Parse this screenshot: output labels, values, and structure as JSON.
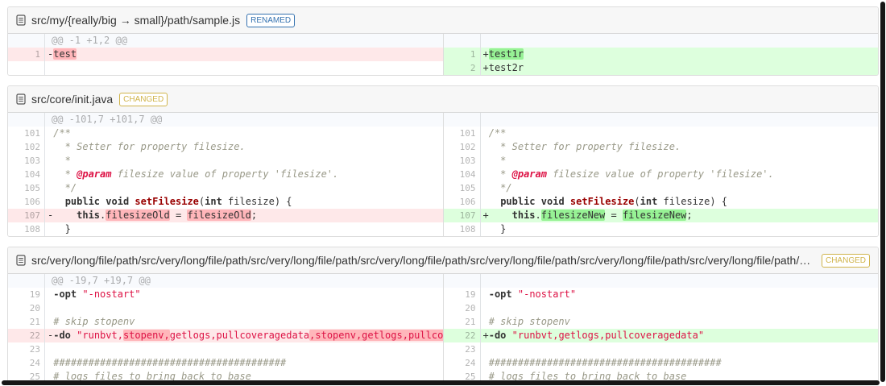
{
  "colors": {
    "renamed_badge": "#3572b0",
    "changed_badge": "#d0b44c",
    "del_line_bg": "#fee8e9",
    "del_word_highlight": "#ffb6ba",
    "ins_line_bg": "#ddffdd",
    "ins_word_highlight": "#97f295",
    "hunk_header_bg": "#f8fafd",
    "file_header_bg": "#f7f7f7"
  },
  "files": [
    {
      "name": "src/my/{really/big → small}/path/sample.js",
      "badge": "RENAMED",
      "badge_type": "renamed",
      "hunk": "@@ -1 +1,2 @@",
      "left_rows": [
        {
          "n": "1",
          "t": "del",
          "s": [
            [
              "pln",
              "-"
            ],
            [
              "hl",
              "test"
            ]
          ]
        },
        {
          "t": "blank",
          "s": []
        }
      ],
      "right_rows": [
        {
          "n": "1",
          "t": "ins",
          "s": [
            [
              "pln",
              "+"
            ],
            [
              "hl",
              "test1r"
            ]
          ]
        },
        {
          "n": "2",
          "t": "ins",
          "s": [
            [
              "pln",
              "+test2r"
            ]
          ]
        }
      ]
    },
    {
      "name": "src/core/init.java",
      "badge": "CHANGED",
      "badge_type": "changed",
      "hunk": "@@ -101,7 +101,7 @@",
      "left_rows": [
        {
          "n": "101",
          "t": "ctx",
          "s": [
            [
              "cmt",
              " /**"
            ]
          ]
        },
        {
          "n": "102",
          "t": "ctx",
          "s": [
            [
              "cmt",
              "   * Setter for property filesize."
            ]
          ]
        },
        {
          "n": "103",
          "t": "ctx",
          "s": [
            [
              "cmt",
              "   *"
            ]
          ]
        },
        {
          "n": "104",
          "t": "ctx",
          "s": [
            [
              "cmt",
              "   * "
            ],
            [
              "doc",
              "@param"
            ],
            [
              "cmt",
              " filesize value of property 'filesize'."
            ]
          ]
        },
        {
          "n": "105",
          "t": "ctx",
          "s": [
            [
              "cmt",
              "   */"
            ]
          ]
        },
        {
          "n": "106",
          "t": "ctx",
          "s": [
            [
              "pln",
              "   "
            ],
            [
              "kw",
              "public"
            ],
            [
              "pln",
              " "
            ],
            [
              "kw",
              "void"
            ],
            [
              "pln",
              " "
            ],
            [
              "title",
              "setFilesize"
            ],
            [
              "pln",
              "("
            ],
            [
              "kw",
              "int"
            ],
            [
              "pln",
              " filesize) {"
            ]
          ]
        },
        {
          "n": "107",
          "t": "del",
          "s": [
            [
              "pln",
              "-    "
            ],
            [
              "kw",
              "this"
            ],
            [
              "pln",
              "."
            ],
            [
              "hl",
              "filesizeOld"
            ],
            [
              "pln",
              " = "
            ],
            [
              "hl",
              "filesizeOld"
            ],
            [
              "pln",
              ";"
            ]
          ]
        },
        {
          "n": "108",
          "t": "ctx",
          "s": [
            [
              "pln",
              "   }"
            ]
          ]
        }
      ],
      "right_rows": [
        {
          "n": "101",
          "t": "ctx",
          "s": [
            [
              "cmt",
              " /**"
            ]
          ]
        },
        {
          "n": "102",
          "t": "ctx",
          "s": [
            [
              "cmt",
              "   * Setter for property filesize."
            ]
          ]
        },
        {
          "n": "103",
          "t": "ctx",
          "s": [
            [
              "cmt",
              "   *"
            ]
          ]
        },
        {
          "n": "104",
          "t": "ctx",
          "s": [
            [
              "cmt",
              "   * "
            ],
            [
              "doc",
              "@param"
            ],
            [
              "cmt",
              " filesize value of property 'filesize'."
            ]
          ]
        },
        {
          "n": "105",
          "t": "ctx",
          "s": [
            [
              "cmt",
              "   */"
            ]
          ]
        },
        {
          "n": "106",
          "t": "ctx",
          "s": [
            [
              "pln",
              "   "
            ],
            [
              "kw",
              "public"
            ],
            [
              "pln",
              " "
            ],
            [
              "kw",
              "void"
            ],
            [
              "pln",
              " "
            ],
            [
              "title",
              "setFilesize"
            ],
            [
              "pln",
              "("
            ],
            [
              "kw",
              "int"
            ],
            [
              "pln",
              " filesize) {"
            ]
          ]
        },
        {
          "n": "107",
          "t": "ins",
          "s": [
            [
              "pln",
              "+    "
            ],
            [
              "kw",
              "this"
            ],
            [
              "pln",
              "."
            ],
            [
              "hl",
              "filesizeNew"
            ],
            [
              "pln",
              " = "
            ],
            [
              "hl",
              "filesizeNew"
            ],
            [
              "pln",
              ";"
            ]
          ]
        },
        {
          "n": "108",
          "t": "ctx",
          "s": [
            [
              "pln",
              "   }"
            ]
          ]
        }
      ]
    },
    {
      "name": "src/very/long/file/path/src/very/long/file/path/src/very/long/file/path/src/very/long/file/path/src/very/long/file/path/src/very/long/file/path/src/very/long/file/path/src/very/long/file/path",
      "badge": "CHANGED",
      "badge_type": "changed",
      "hunk": "@@ -19,7 +19,7 @@",
      "left_rows": [
        {
          "n": "19",
          "t": "ctx",
          "s": [
            [
              "pln",
              " "
            ],
            [
              "kw",
              "-opt"
            ],
            [
              "pln",
              " "
            ],
            [
              "str",
              "\"-nostart\""
            ]
          ]
        },
        {
          "n": "20",
          "t": "ctx",
          "s": []
        },
        {
          "n": "21",
          "t": "ctx",
          "s": [
            [
              "pln",
              " "
            ],
            [
              "cmt",
              "# skip stopenv"
            ]
          ]
        },
        {
          "n": "22",
          "t": "del",
          "s": [
            [
              "pln",
              "-"
            ],
            [
              "kw",
              "-do"
            ],
            [
              "pln",
              " "
            ],
            [
              "str",
              "\"runbvt,"
            ],
            [
              "str hl",
              "stopenv,"
            ],
            [
              "str",
              "getlogs,pullcoveragedata"
            ],
            [
              "str hl",
              ",stopenv,getlogs,pullcoveragedata\""
            ]
          ]
        },
        {
          "n": "23",
          "t": "ctx",
          "s": []
        },
        {
          "n": "24",
          "t": "ctx",
          "s": [
            [
              "pln",
              " "
            ],
            [
              "cmt",
              "########################################"
            ]
          ]
        },
        {
          "n": "25",
          "t": "ctx",
          "s": [
            [
              "pln",
              " "
            ],
            [
              "cmt",
              "# logs files to bring back to base"
            ]
          ]
        }
      ],
      "right_rows": [
        {
          "n": "19",
          "t": "ctx",
          "s": [
            [
              "pln",
              " "
            ],
            [
              "kw",
              "-opt"
            ],
            [
              "pln",
              " "
            ],
            [
              "str",
              "\"-nostart\""
            ]
          ]
        },
        {
          "n": "20",
          "t": "ctx",
          "s": []
        },
        {
          "n": "21",
          "t": "ctx",
          "s": [
            [
              "pln",
              " "
            ],
            [
              "cmt",
              "# skip stopenv"
            ]
          ]
        },
        {
          "n": "22",
          "t": "ins",
          "s": [
            [
              "pln",
              "+"
            ],
            [
              "kw",
              "-do"
            ],
            [
              "pln",
              " "
            ],
            [
              "str",
              "\"runbvt,getlogs,pullcoveragedata\""
            ]
          ]
        },
        {
          "n": "23",
          "t": "ctx",
          "s": []
        },
        {
          "n": "24",
          "t": "ctx",
          "s": [
            [
              "pln",
              " "
            ],
            [
              "cmt",
              "########################################"
            ]
          ]
        },
        {
          "n": "25",
          "t": "ctx",
          "s": [
            [
              "pln",
              " "
            ],
            [
              "cmt",
              "# logs files to bring back to base"
            ]
          ]
        }
      ]
    }
  ]
}
